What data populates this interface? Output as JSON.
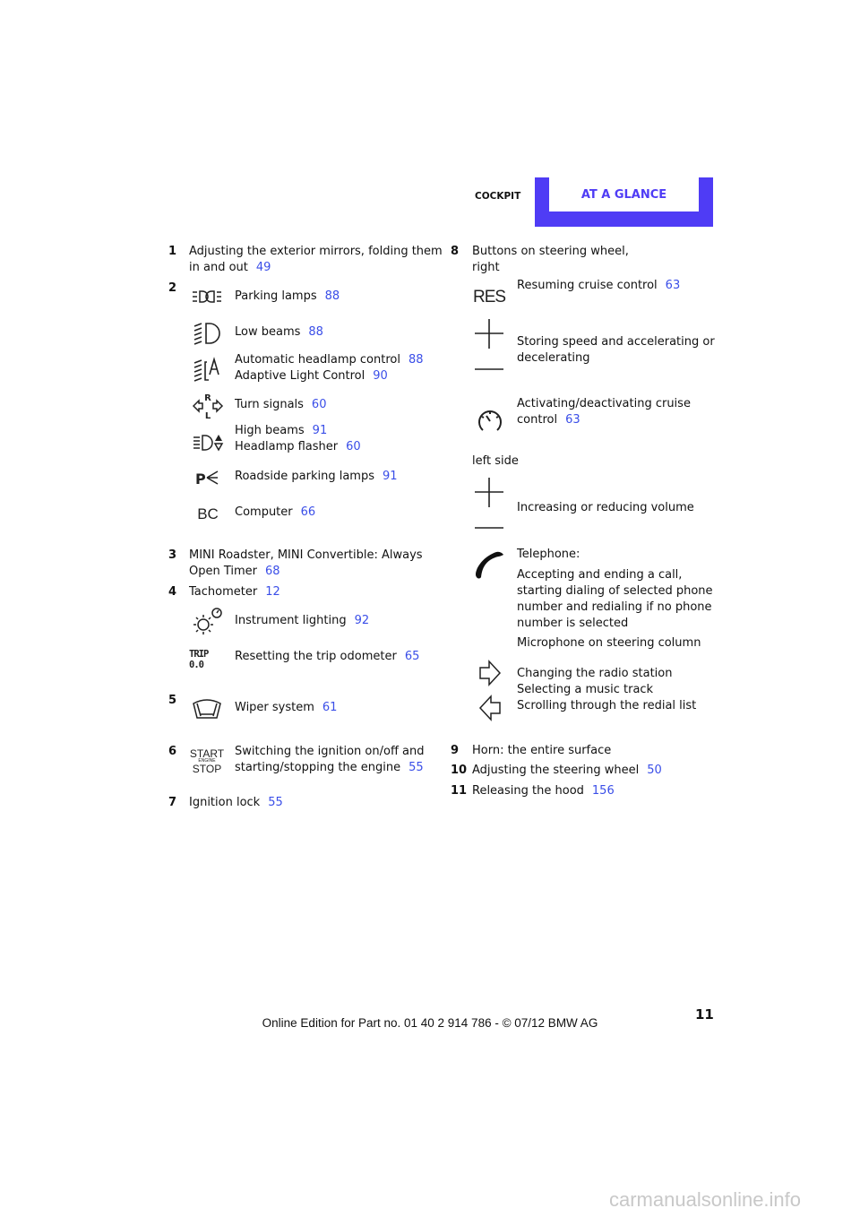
{
  "header": {
    "section": "COCKPIT",
    "tab": "AT A GLANCE",
    "accent": "#4f3cf5",
    "link_color": "#3a4ee8"
  },
  "left": {
    "i1": {
      "num": "1",
      "text1": "Adjusting the exterior mirrors, folding them",
      "text2": "in and out",
      "ref": "49"
    },
    "i2": {
      "num": "2",
      "rows": [
        {
          "text": "Parking lamps",
          "ref": "88"
        },
        {
          "text": "Low beams",
          "ref": "88"
        },
        {
          "text": "Automatic headlamp control",
          "ref": "88"
        },
        {
          "text": "Adaptive Light Control",
          "ref": "90"
        },
        {
          "text": "Turn signals",
          "ref": "60"
        },
        {
          "text": "High beams",
          "ref": "91"
        },
        {
          "text": "Headlamp flasher",
          "ref": "60"
        },
        {
          "text": "Roadside parking lamps",
          "ref": "91"
        },
        {
          "text": "Computer",
          "ref": "66"
        }
      ]
    },
    "i3": {
      "num": "3",
      "text1": "MINI Roadster, MINI Convertible: Always",
      "text2": "Open Timer",
      "ref": "68"
    },
    "i4": {
      "num": "4",
      "text": "Tachometer",
      "ref": "12",
      "rows": [
        {
          "text": "Instrument lighting",
          "ref": "92"
        },
        {
          "text": "Resetting the trip odometer",
          "ref": "65"
        }
      ]
    },
    "i5": {
      "num": "5",
      "text": "Wiper system",
      "ref": "61"
    },
    "i6": {
      "num": "6",
      "text1": "Switching the ignition on/off and",
      "text2": "starting/stopping the engine",
      "ref": "55"
    },
    "i7": {
      "num": "7",
      "text": "Ignition lock",
      "ref": "55"
    }
  },
  "icons": {
    "bc": "BC",
    "trip": "TRIP 0.0",
    "start": "START",
    "engine": "ENGINE",
    "stop": "STOP",
    "res": "RES",
    "r": "R",
    "l": "L"
  },
  "right": {
    "i8": {
      "num": "8",
      "text1": "Buttons on steering wheel,",
      "text2": "right",
      "res": {
        "text": "Resuming cruise control",
        "ref": "63"
      },
      "store1": "Storing speed and accelerating or",
      "store2": "decelerating",
      "act1": "Activating/deactivating cruise",
      "act2": "control",
      "act_ref": "63",
      "left_side": "left side",
      "volume": "Increasing or reducing volume",
      "tel": "Telephone:",
      "tel1": "Accepting and ending a call,",
      "tel2": "starting dialing of selected phone",
      "tel3": "number and redialing if no phone",
      "tel4": "number is selected",
      "mic": "Microphone on steering column",
      "radio": "Changing the radio station",
      "music": "Selecting a music track",
      "redial": "Scrolling through the redial list"
    },
    "i9": {
      "num": "9",
      "text": "Horn: the entire surface"
    },
    "i10": {
      "num": "10",
      "text": "Adjusting the steering wheel",
      "ref": "50"
    },
    "i11": {
      "num": "11",
      "text": "Releasing the hood",
      "ref": "156"
    }
  },
  "footer": {
    "text": "Online Edition for Part no. 01 40 2 914 786 - © 07/12 BMW AG",
    "page": "11",
    "watermark": "carmanualsonline.info"
  }
}
